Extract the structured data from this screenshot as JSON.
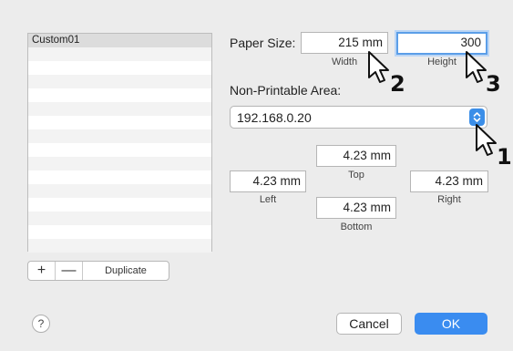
{
  "custom_list": {
    "items": [
      "Custom01"
    ],
    "add_label": "+",
    "remove_label": "—",
    "duplicate_label": "Duplicate"
  },
  "paper_size": {
    "label": "Paper Size:",
    "width_value": "215 mm",
    "width_label": "Width",
    "height_value": "300",
    "height_label": "Height"
  },
  "non_printable": {
    "label": "Non-Printable Area:",
    "preset_value": "192.168.0.20",
    "top_value": "4.23 mm",
    "top_label": "Top",
    "left_value": "4.23 mm",
    "left_label": "Left",
    "right_value": "4.23 mm",
    "right_label": "Right",
    "bottom_value": "4.23 mm",
    "bottom_label": "Bottom"
  },
  "footer": {
    "help_label": "?",
    "cancel_label": "Cancel",
    "ok_label": "OK"
  },
  "callouts": [
    "1",
    "2",
    "3"
  ],
  "colors": {
    "accent": "#3a8cf0",
    "focus_ring": "#5b9ee8",
    "selection": "#dcdcdc"
  }
}
